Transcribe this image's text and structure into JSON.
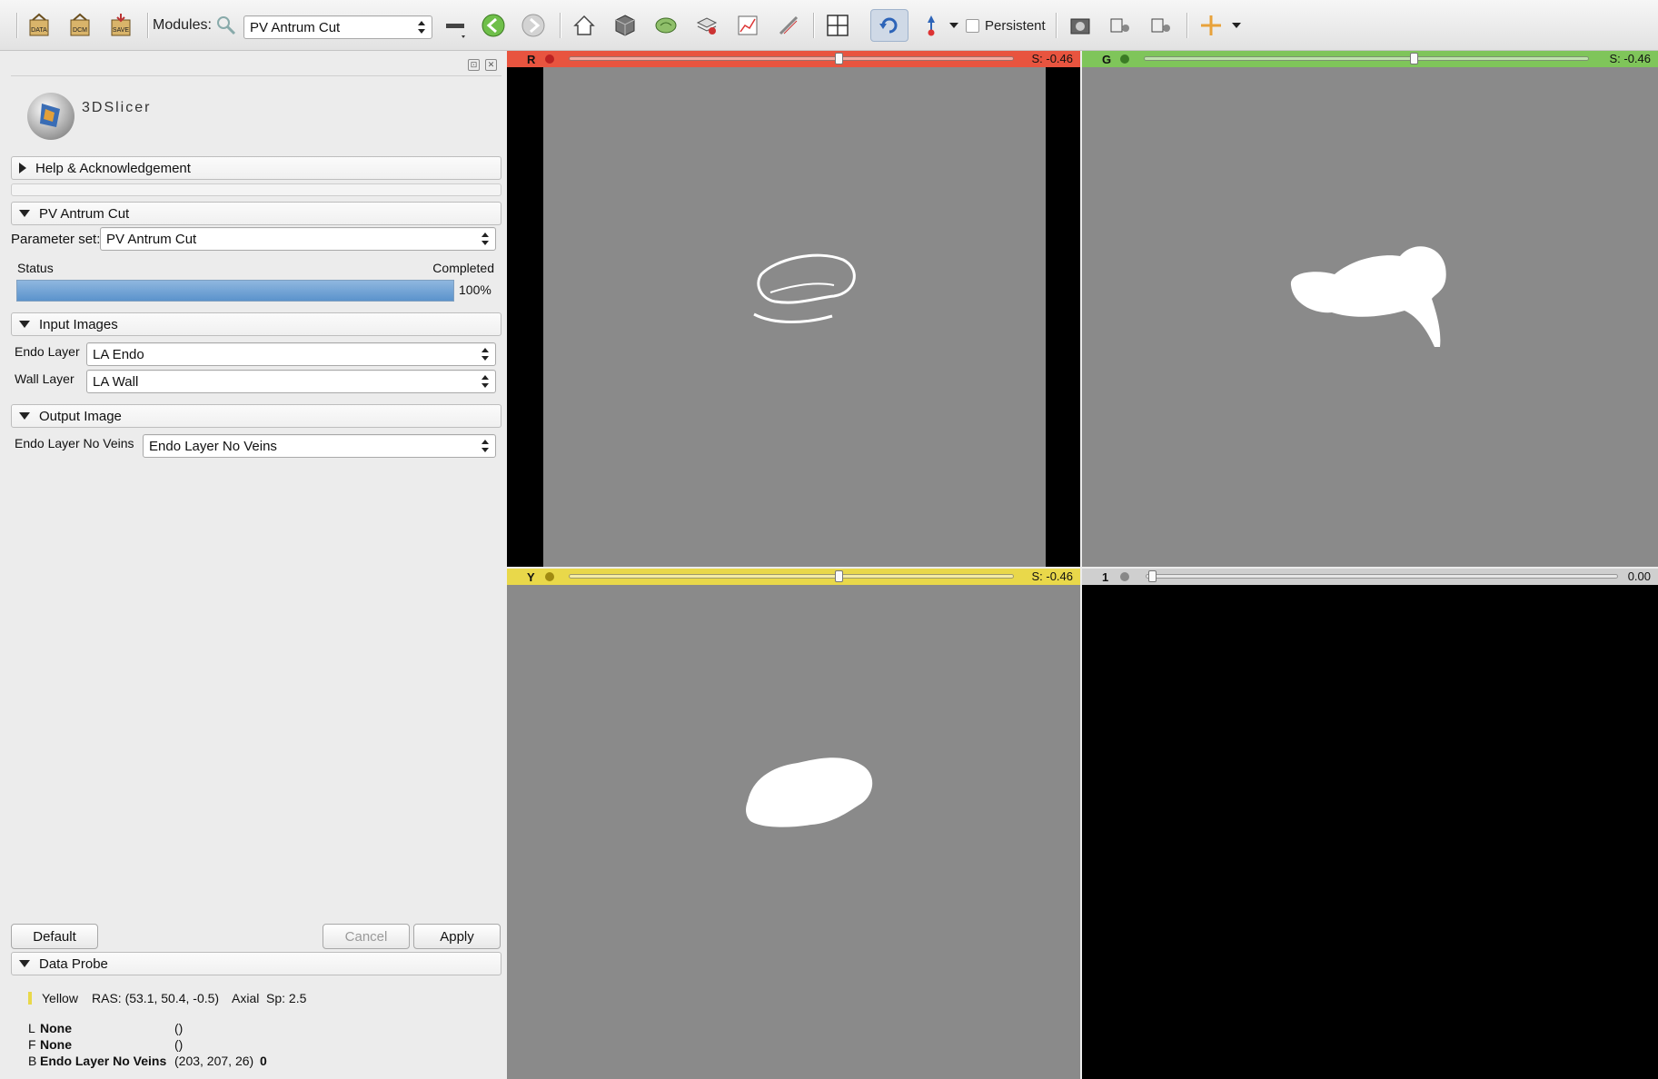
{
  "toolbar": {
    "load_data_icon": "DATA",
    "dicom_icon": "DCM",
    "save_icon": "SAVE",
    "modules_label": "Modules:",
    "module_selected": "PV Antrum Cut",
    "persistent_label": "Persistent"
  },
  "panel": {
    "logo_text": "3DSlicer",
    "help_section": "Help & Acknowledgement",
    "module_section": "PV Antrum Cut",
    "parameter_set_label": "Parameter set:",
    "parameter_set_value": "PV Antrum Cut",
    "status_label": "Status",
    "status_value": "Completed",
    "progress_percent": 100,
    "progress_text": "100%",
    "input_section": "Input Images",
    "endo_label": "Endo Layer",
    "endo_value": "LA Endo",
    "wall_label": "Wall Layer",
    "wall_value": "LA Wall",
    "output_section": "Output Image",
    "output_label": "Endo Layer No Veins",
    "output_value": "Endo Layer No Veins",
    "default_button": "Default",
    "cancel_button": "Cancel",
    "apply_button": "Apply",
    "probe_section": "Data Probe"
  },
  "probe": {
    "view": "Yellow",
    "ras": "RAS: (53.1, 50.4, -0.5)",
    "orientation": "Axial",
    "spacing": "Sp: 2.5",
    "rows": [
      {
        "key": "L",
        "name": "None",
        "value": "()",
        "extra": ""
      },
      {
        "key": "F",
        "name": "None",
        "value": "()",
        "extra": ""
      },
      {
        "key": "B",
        "name": "Endo Layer No Veins",
        "value": "(203, 207, 26)",
        "extra": "0"
      }
    ]
  },
  "views": {
    "red": {
      "letter": "R",
      "offset": "S: -0.46",
      "color": "#e8543f"
    },
    "green": {
      "letter": "G",
      "offset": "S: -0.46",
      "color": "#7fc55a"
    },
    "yellow": {
      "letter": "Y",
      "offset": "S: -0.46",
      "color": "#e9d84a"
    },
    "threed": {
      "letter": "1",
      "offset": "0.00",
      "color": "#cfcfcf"
    }
  }
}
